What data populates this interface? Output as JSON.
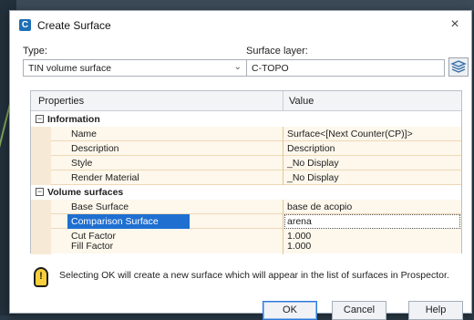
{
  "dialog": {
    "title": "Create Surface",
    "close_label": "×"
  },
  "type": {
    "label": "Type:",
    "value": "TIN volume surface"
  },
  "surface_layer": {
    "label": "Surface layer:",
    "value": "C-TOPO"
  },
  "grid": {
    "col_properties": "Properties",
    "col_value": "Value",
    "categories": [
      {
        "name": "Information",
        "toggle": "−",
        "rows": [
          {
            "name": "Name",
            "value": "Surface<[Next Counter(CP)]>"
          },
          {
            "name": "Description",
            "value": "Description"
          },
          {
            "name": "Style",
            "value": "_No Display"
          },
          {
            "name": "Render Material",
            "value": "_No Display"
          }
        ]
      },
      {
        "name": "Volume surfaces",
        "toggle": "−",
        "rows": [
          {
            "name": "Base Surface",
            "value": "base de acopio"
          },
          {
            "name": "Comparison Surface",
            "value": "arena"
          },
          {
            "name": "Cut Factor",
            "value": "1.000"
          },
          {
            "name": "Fill Factor",
            "value": "1.000"
          }
        ]
      }
    ]
  },
  "info": {
    "icon": "lightbulb-icon",
    "text": "Selecting OK will create a new surface which will appear in the list of surfaces in Prospector."
  },
  "buttons": {
    "ok": "OK",
    "cancel": "Cancel",
    "help": "Help"
  },
  "colors": {
    "selection": "#1f6fd1",
    "row_bg": "#fdf7ec"
  }
}
